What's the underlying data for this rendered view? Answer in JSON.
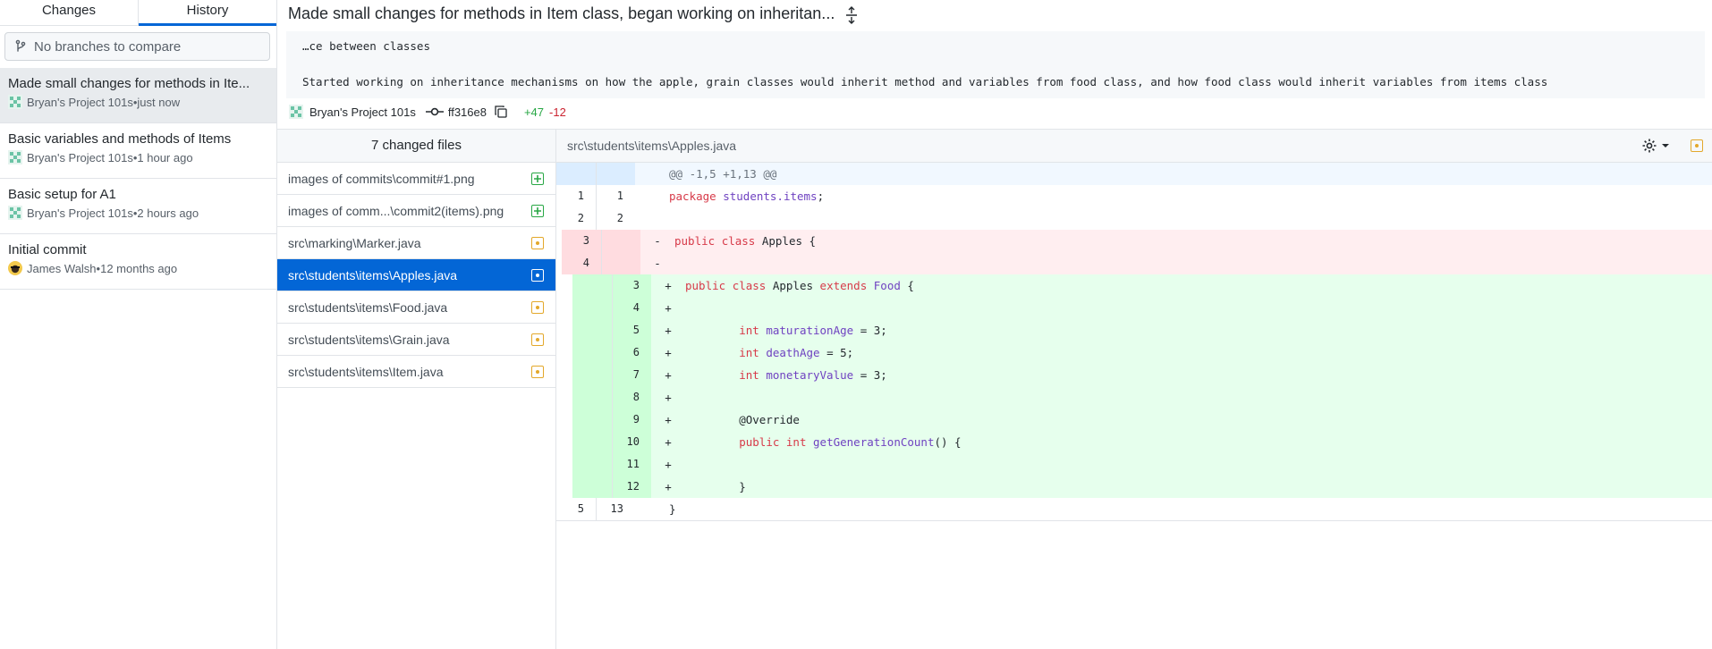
{
  "sidebar": {
    "tabs": [
      {
        "label": "Changes"
      },
      {
        "label": "History"
      }
    ],
    "compare_placeholder": "No branches to compare",
    "commits": [
      {
        "title": "Made small changes for methods in Ite...",
        "author": "Bryan's Project 101s",
        "time": "just now"
      },
      {
        "title": "Basic variables and methods of Items",
        "author": "Bryan's Project 101s",
        "time": "1 hour ago"
      },
      {
        "title": "Basic setup for A1",
        "author": "Bryan's Project 101s",
        "time": "2 hours ago"
      },
      {
        "title": "Initial commit",
        "author": "James Walsh",
        "time": "12 months ago"
      }
    ],
    "separator": " • "
  },
  "commit": {
    "summary": "Made small changes for methods in Item class, began working on inheritan...",
    "description_line1": "…ce between classes",
    "description_line2": "Started working on inheritance mechanisms on how the apple, grain classes would inherit method and variables from food class, and how food class would inherit variables from items class",
    "author": "Bryan's Project 101s",
    "sha": "ff316e8",
    "additions": "+47",
    "deletions": "-12"
  },
  "files": {
    "header": "7 changed files",
    "items": [
      {
        "name": "images of commits\\commit#1.png",
        "status": "added"
      },
      {
        "name": "images of comm...\\commit2(items).png",
        "status": "added"
      },
      {
        "name": "src\\marking\\Marker.java",
        "status": "modified"
      },
      {
        "name": "src\\students\\items\\Apples.java",
        "status": "modified"
      },
      {
        "name": "src\\students\\items\\Food.java",
        "status": "modified"
      },
      {
        "name": "src\\students\\items\\Grain.java",
        "status": "modified"
      },
      {
        "name": "src\\students\\items\\Item.java",
        "status": "modified"
      }
    ]
  },
  "diff": {
    "path": "src\\students\\items\\Apples.java",
    "hunk_header": "@@ -1,5 +1,13 @@",
    "lines": [
      {
        "type": "ctx",
        "old": "1",
        "new": "1",
        "marker": "",
        "tokens": [
          [
            "kw",
            "package"
          ],
          [
            "pl",
            " "
          ],
          [
            "ty",
            "students.items"
          ],
          [
            "pl",
            ";"
          ]
        ]
      },
      {
        "type": "ctx",
        "old": "2",
        "new": "2",
        "marker": "",
        "tokens": []
      },
      {
        "type": "del",
        "old": "3",
        "new": "",
        "marker": "-",
        "tokens": [
          [
            "kw",
            "public"
          ],
          [
            "pl",
            " "
          ],
          [
            "kw",
            "class"
          ],
          [
            "pl",
            " Apples {"
          ]
        ]
      },
      {
        "type": "del",
        "old": "4",
        "new": "",
        "marker": "-",
        "tokens": []
      },
      {
        "type": "add",
        "old": "",
        "new": "3",
        "marker": "+",
        "tokens": [
          [
            "kw",
            "public"
          ],
          [
            "pl",
            " "
          ],
          [
            "kw",
            "class"
          ],
          [
            "pl",
            " Apples "
          ],
          [
            "kw",
            "extends"
          ],
          [
            "pl",
            " "
          ],
          [
            "ty",
            "Food"
          ],
          [
            "pl",
            " {"
          ]
        ]
      },
      {
        "type": "add",
        "old": "",
        "new": "4",
        "marker": "+",
        "tokens": []
      },
      {
        "type": "add",
        "old": "",
        "new": "5",
        "marker": "+",
        "tokens": [
          [
            "pl",
            "        "
          ],
          [
            "kw",
            "int"
          ],
          [
            "pl",
            " "
          ],
          [
            "ty",
            "maturationAge"
          ],
          [
            "pl",
            " = 3;"
          ]
        ]
      },
      {
        "type": "add",
        "old": "",
        "new": "6",
        "marker": "+",
        "tokens": [
          [
            "pl",
            "        "
          ],
          [
            "kw",
            "int"
          ],
          [
            "pl",
            " "
          ],
          [
            "ty",
            "deathAge"
          ],
          [
            "pl",
            " = 5;"
          ]
        ]
      },
      {
        "type": "add",
        "old": "",
        "new": "7",
        "marker": "+",
        "tokens": [
          [
            "pl",
            "        "
          ],
          [
            "kw",
            "int"
          ],
          [
            "pl",
            " "
          ],
          [
            "ty",
            "monetaryValue"
          ],
          [
            "pl",
            " = 3;"
          ]
        ]
      },
      {
        "type": "add",
        "old": "",
        "new": "8",
        "marker": "+",
        "tokens": []
      },
      {
        "type": "add",
        "old": "",
        "new": "9",
        "marker": "+",
        "tokens": [
          [
            "pl",
            "        @Override"
          ]
        ]
      },
      {
        "type": "add",
        "old": "",
        "new": "10",
        "marker": "+",
        "tokens": [
          [
            "pl",
            "        "
          ],
          [
            "kw",
            "public"
          ],
          [
            "pl",
            " "
          ],
          [
            "kw",
            "int"
          ],
          [
            "pl",
            " "
          ],
          [
            "ty",
            "getGenerationCount"
          ],
          [
            "pl",
            "() {"
          ]
        ]
      },
      {
        "type": "add",
        "old": "",
        "new": "11",
        "marker": "+",
        "tokens": []
      },
      {
        "type": "add",
        "old": "",
        "new": "12",
        "marker": "+",
        "tokens": [
          [
            "pl",
            "        }"
          ]
        ]
      },
      {
        "type": "ctx",
        "old": "5",
        "new": "13",
        "marker": "",
        "tokens": [
          [
            "pl",
            "}"
          ]
        ]
      }
    ]
  },
  "colors": {
    "accent": "#0366d6",
    "added": "#28a745",
    "modified": "#e3a82b",
    "deleted": "#cb2431"
  },
  "icons": {
    "compare": "git-branch-icon",
    "expand": "expand-vertical-icon",
    "commit": "git-commit-icon",
    "copy": "copy-icon",
    "settings": "gear-icon"
  }
}
